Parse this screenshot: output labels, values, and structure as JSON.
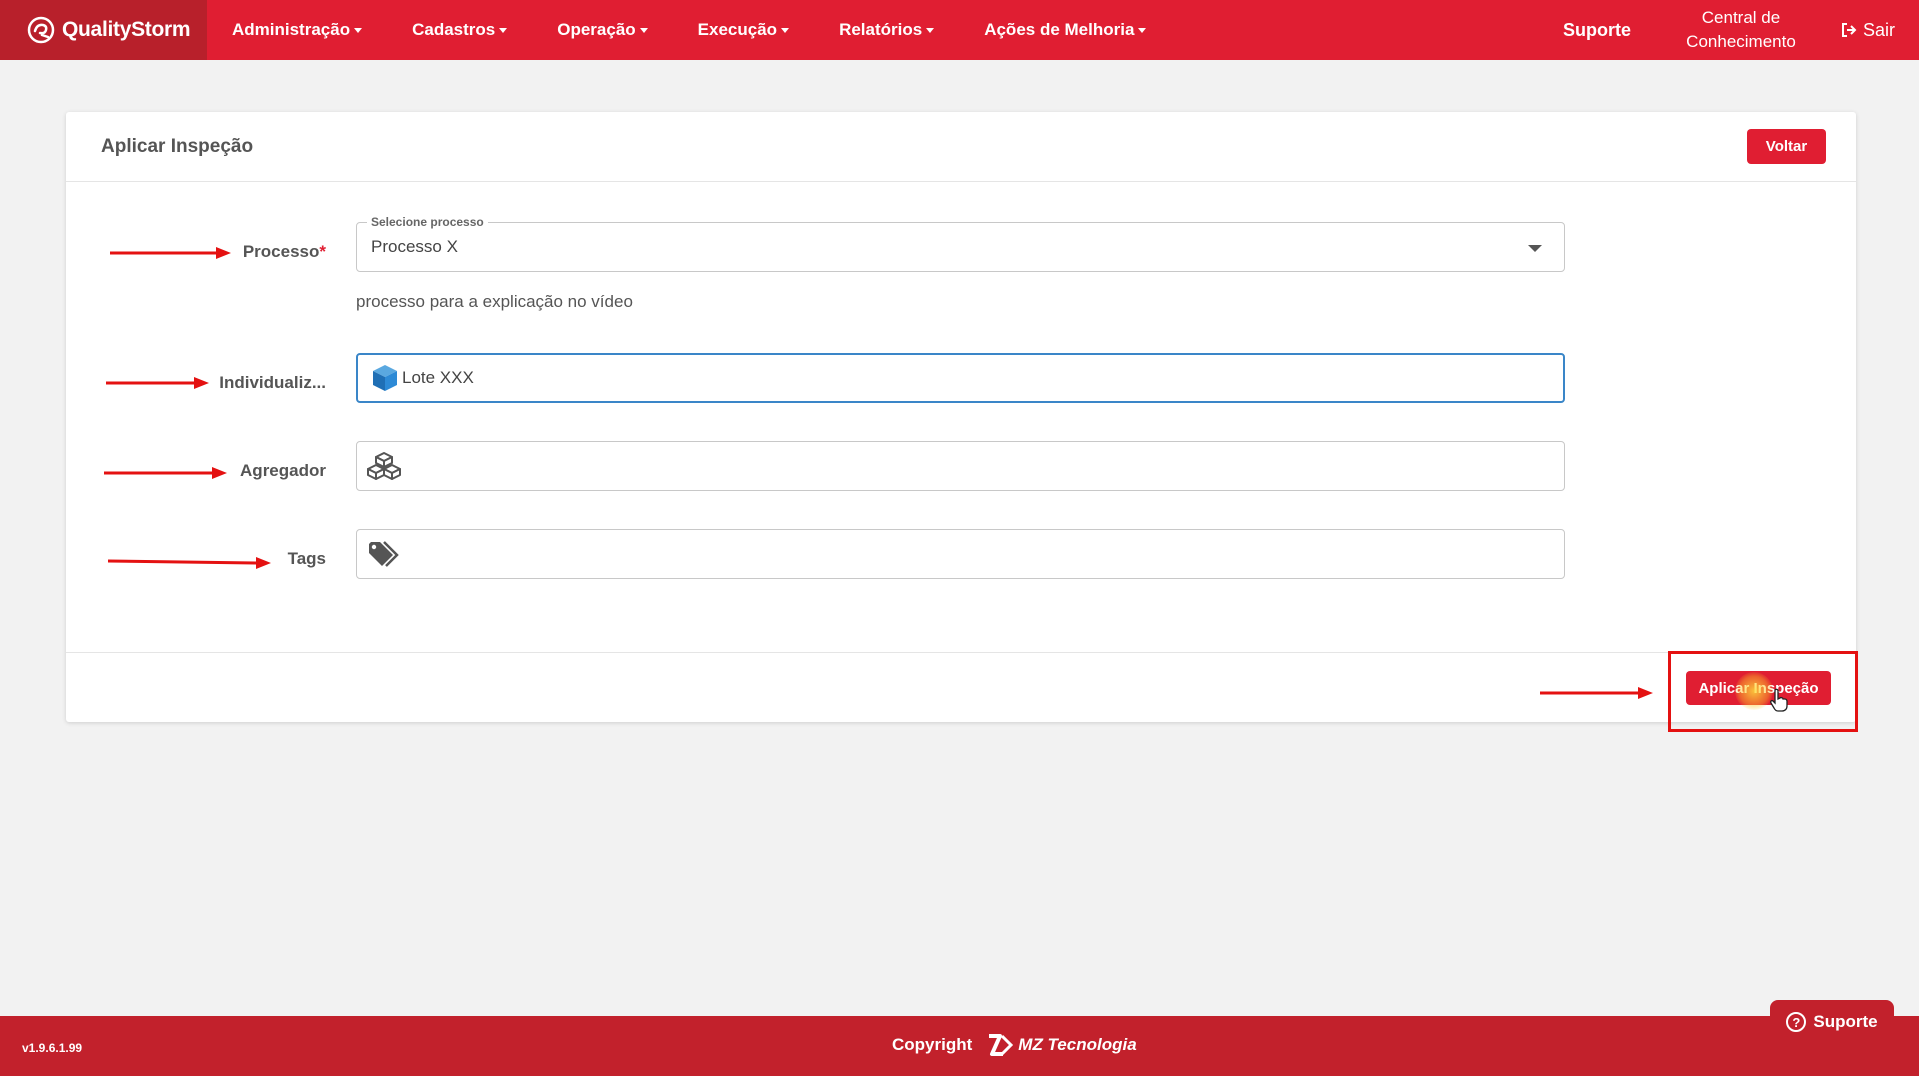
{
  "brand": {
    "name": "QualityStorm"
  },
  "nav": {
    "items": [
      {
        "label": "Administração"
      },
      {
        "label": "Cadastros"
      },
      {
        "label": "Operação"
      },
      {
        "label": "Execução"
      },
      {
        "label": "Relatórios"
      },
      {
        "label": "Ações de Melhoria"
      }
    ],
    "suporte": "Suporte",
    "central_line1": "Central de",
    "central_line2": "Conhecimento",
    "sair": "Sair"
  },
  "card": {
    "title": "Aplicar Inspeção",
    "back_button": "Voltar",
    "processo": {
      "label": "Processo",
      "required_mark": "*",
      "legend": "Selecione processo",
      "value": "Processo X",
      "help": "processo para a explicação no vídeo"
    },
    "individualizador": {
      "label": "Individualiz...",
      "value": "Lote XXX"
    },
    "agregador": {
      "label": "Agregador",
      "value": ""
    },
    "tags": {
      "label": "Tags",
      "value": ""
    },
    "submit_button": "Aplicar Inspeção"
  },
  "footer": {
    "version": "v1.9.6.1.99",
    "copyright": "Copyright",
    "company": "MZ Tecnologia"
  },
  "floating_support": {
    "label": "Suporte"
  },
  "colors": {
    "primary": "#e01e32",
    "brand_dark": "#b8202b",
    "footer": "#c2212c",
    "focus": "#3a86c8",
    "annotation": "#e41111"
  }
}
